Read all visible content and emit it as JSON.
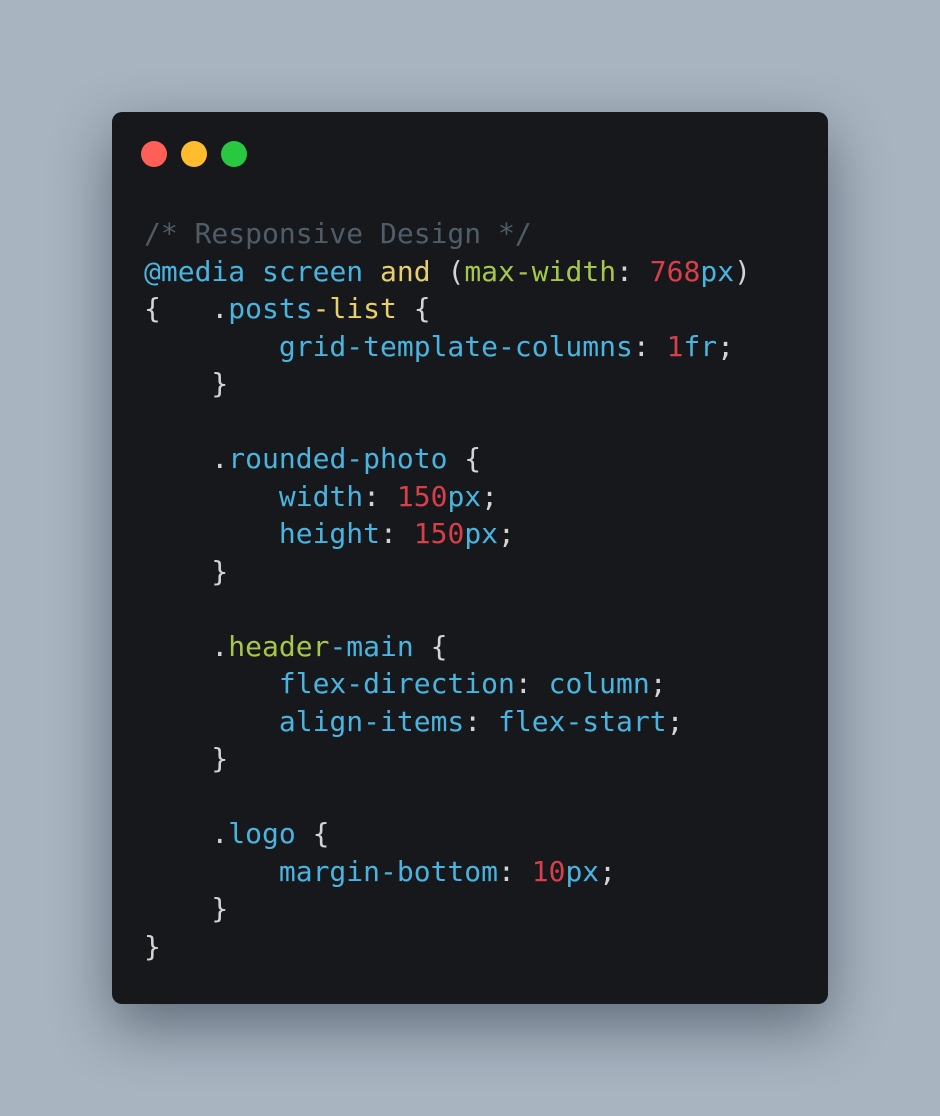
{
  "window": {
    "controls": [
      {
        "name": "close",
        "color": "#fe5f57"
      },
      {
        "name": "minimize",
        "color": "#febc2e"
      },
      {
        "name": "maximize",
        "color": "#28c840"
      }
    ]
  },
  "colors": {
    "background": "#a8b4c0",
    "window": "#17181b",
    "comment": "#4e5d68",
    "at_rule": "#4ab4e0",
    "keyword": "#e7cf6b",
    "string_like": "#a6c84a",
    "number": "#d7404a",
    "property": "#4ab4e0",
    "punct": "#d4d4d4"
  },
  "code": {
    "lines": [
      [
        {
          "t": "/* Responsive Design */",
          "c": "comment"
        }
      ],
      [
        {
          "t": "@media",
          "c": "at_rule"
        },
        {
          "t": " ",
          "c": "punct"
        },
        {
          "t": "screen",
          "c": "property"
        },
        {
          "t": " ",
          "c": "punct"
        },
        {
          "t": "and",
          "c": "keyword"
        },
        {
          "t": " (",
          "c": "punct"
        },
        {
          "t": "max-width",
          "c": "string_like"
        },
        {
          "t": ": ",
          "c": "punct"
        },
        {
          "t": "768",
          "c": "number"
        },
        {
          "t": "px",
          "c": "property"
        },
        {
          "t": ")",
          "c": "punct"
        }
      ],
      [
        {
          "t": "{   .",
          "c": "punct"
        },
        {
          "t": "posts",
          "c": "property"
        },
        {
          "t": "-",
          "c": "keyword"
        },
        {
          "t": "list",
          "c": "keyword"
        },
        {
          "t": " {",
          "c": "punct"
        }
      ],
      [
        {
          "t": "        ",
          "c": "punct"
        },
        {
          "t": "grid-template-columns",
          "c": "property"
        },
        {
          "t": ": ",
          "c": "punct"
        },
        {
          "t": "1",
          "c": "number"
        },
        {
          "t": "fr",
          "c": "property"
        },
        {
          "t": ";",
          "c": "punct"
        }
      ],
      [
        {
          "t": "    }",
          "c": "punct"
        }
      ],
      [
        {
          "t": "",
          "c": "punct"
        }
      ],
      [
        {
          "t": "    .",
          "c": "punct"
        },
        {
          "t": "rounded-photo",
          "c": "property"
        },
        {
          "t": " {",
          "c": "punct"
        }
      ],
      [
        {
          "t": "        ",
          "c": "punct"
        },
        {
          "t": "width",
          "c": "property"
        },
        {
          "t": ": ",
          "c": "punct"
        },
        {
          "t": "150",
          "c": "number"
        },
        {
          "t": "px",
          "c": "property"
        },
        {
          "t": ";",
          "c": "punct"
        }
      ],
      [
        {
          "t": "        ",
          "c": "punct"
        },
        {
          "t": "height",
          "c": "property"
        },
        {
          "t": ": ",
          "c": "punct"
        },
        {
          "t": "150",
          "c": "number"
        },
        {
          "t": "px",
          "c": "property"
        },
        {
          "t": ";",
          "c": "punct"
        }
      ],
      [
        {
          "t": "    }",
          "c": "punct"
        }
      ],
      [
        {
          "t": "",
          "c": "punct"
        }
      ],
      [
        {
          "t": "    .",
          "c": "punct"
        },
        {
          "t": "header",
          "c": "string_like"
        },
        {
          "t": "-main",
          "c": "property"
        },
        {
          "t": " {",
          "c": "punct"
        }
      ],
      [
        {
          "t": "        ",
          "c": "punct"
        },
        {
          "t": "flex-direction",
          "c": "property"
        },
        {
          "t": ": ",
          "c": "punct"
        },
        {
          "t": "column",
          "c": "property"
        },
        {
          "t": ";",
          "c": "punct"
        }
      ],
      [
        {
          "t": "        ",
          "c": "punct"
        },
        {
          "t": "align-items",
          "c": "property"
        },
        {
          "t": ": ",
          "c": "punct"
        },
        {
          "t": "flex-start",
          "c": "property"
        },
        {
          "t": ";",
          "c": "punct"
        }
      ],
      [
        {
          "t": "    }",
          "c": "punct"
        }
      ],
      [
        {
          "t": "",
          "c": "punct"
        }
      ],
      [
        {
          "t": "    .",
          "c": "punct"
        },
        {
          "t": "logo",
          "c": "property"
        },
        {
          "t": " {",
          "c": "punct"
        }
      ],
      [
        {
          "t": "        ",
          "c": "punct"
        },
        {
          "t": "margin-bottom",
          "c": "property"
        },
        {
          "t": ": ",
          "c": "punct"
        },
        {
          "t": "10",
          "c": "number"
        },
        {
          "t": "px",
          "c": "property"
        },
        {
          "t": ";",
          "c": "punct"
        }
      ],
      [
        {
          "t": "    }",
          "c": "punct"
        }
      ],
      [
        {
          "t": "}",
          "c": "punct"
        }
      ]
    ]
  }
}
